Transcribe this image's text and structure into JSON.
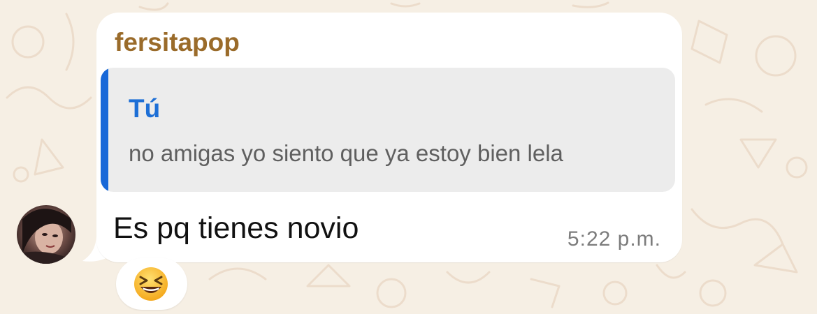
{
  "chat": {
    "sender_name": "fersitapop",
    "quoted_message": {
      "author": "Tú",
      "text": "no amigas yo siento que ya estoy bien lela"
    },
    "message_text": "Es pq tienes novio",
    "timestamp": "5:22 p.m."
  },
  "reaction": {
    "icon": "grinning-squinting-face-icon"
  },
  "avatar": {
    "icon": "profile-photo"
  },
  "colors": {
    "background": "#f6efe4",
    "sender_name": "#9a6b2a",
    "quote_author": "#1d6fd6",
    "quote_bar": "#1868d8",
    "bubble": "#ffffff"
  }
}
